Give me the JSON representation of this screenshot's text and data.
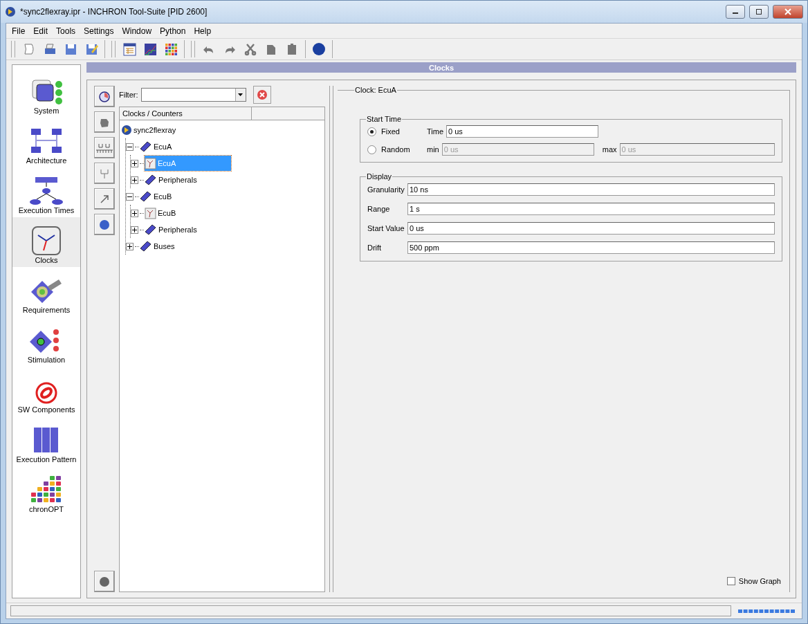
{
  "window": {
    "title": "*sync2flexray.ipr - INCHRON Tool-Suite [PID 2600]"
  },
  "menu": [
    "File",
    "Edit",
    "Tools",
    "Settings",
    "Window",
    "Python",
    "Help"
  ],
  "nav": {
    "items": [
      {
        "label": "System",
        "kind": "system",
        "selected": false
      },
      {
        "label": "Architecture",
        "kind": "architecture",
        "selected": false
      },
      {
        "label": "Execution Times",
        "kind": "times",
        "selected": false
      },
      {
        "label": "Clocks",
        "kind": "clocks",
        "selected": true
      },
      {
        "label": "Requirements",
        "kind": "requirements",
        "selected": false
      },
      {
        "label": "Stimulation",
        "kind": "stimulation",
        "selected": false
      },
      {
        "label": "SW Components",
        "kind": "components",
        "selected": false
      },
      {
        "label": "Execution Pattern",
        "kind": "pattern",
        "selected": false
      },
      {
        "label": "chronOPT",
        "kind": "opt",
        "selected": false
      }
    ]
  },
  "header": {
    "title": "Clocks"
  },
  "filter": {
    "label": "Filter:"
  },
  "tree": {
    "column": "Clocks / Counters",
    "nodes": [
      {
        "label": "sync2flexray",
        "kind": "project",
        "selected": false,
        "children": [
          {
            "label": "EcuA",
            "kind": "ecu",
            "expanded": true,
            "selected": false,
            "children": [
              {
                "label": "EcuA",
                "kind": "clock",
                "expanded": false,
                "selected": true
              },
              {
                "label": "Peripherals",
                "kind": "ecu",
                "expanded": false,
                "selected": false
              }
            ]
          },
          {
            "label": "EcuB",
            "kind": "ecu",
            "expanded": true,
            "selected": false,
            "children": [
              {
                "label": "EcuB",
                "kind": "clock",
                "expanded": false,
                "selected": false
              },
              {
                "label": "Peripherals",
                "kind": "ecu",
                "expanded": false,
                "selected": false
              }
            ]
          },
          {
            "label": "Buses",
            "kind": "ecu",
            "expanded": false,
            "selected": false
          }
        ]
      }
    ]
  },
  "detail": {
    "title": "Clock: EcuA",
    "start_time": {
      "title": "Start Time",
      "options": [
        {
          "label": "Fixed",
          "selected": true,
          "fields": [
            {
              "label": "Time",
              "value": "0 us",
              "disabled": false
            }
          ]
        },
        {
          "label": "Random",
          "selected": false,
          "fields": [
            {
              "label": "min",
              "value": "0 us",
              "disabled": true
            },
            {
              "label": "max",
              "value": "0 us",
              "disabled": true
            }
          ]
        }
      ]
    },
    "display": {
      "title": "Display",
      "fields": [
        {
          "label": "Granularity",
          "value": "10 ns"
        },
        {
          "label": "Range",
          "value": "1 s"
        },
        {
          "label": "Start Value",
          "value": "0 us"
        },
        {
          "label": "Drift",
          "value": "500 ppm"
        }
      ]
    },
    "show_graph": {
      "label": "Show Graph",
      "checked": false
    }
  }
}
